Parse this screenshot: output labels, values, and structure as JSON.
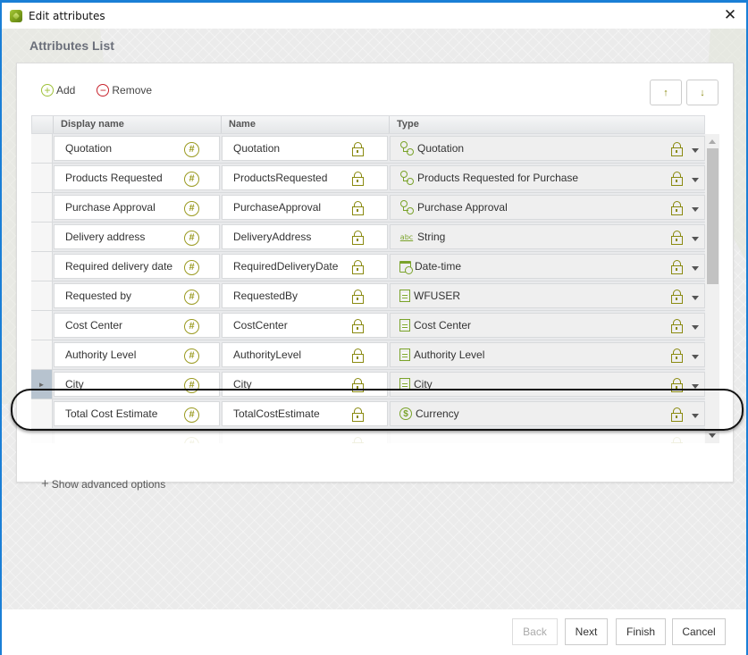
{
  "window": {
    "title": "Edit attributes",
    "close_icon": "close-icon"
  },
  "section_title": "Attributes List",
  "toolbar": {
    "add_label": "Add",
    "remove_label": "Remove",
    "move_up": "↑",
    "move_down": "↓"
  },
  "grid": {
    "columns": [
      "Display name",
      "Name",
      "Type"
    ],
    "rows": [
      {
        "display": "Quotation",
        "name": "Quotation",
        "type": "Quotation",
        "type_icon": "process",
        "selected": false
      },
      {
        "display": "Products Requested",
        "name": "ProductsRequested",
        "type": "Products Requested for Purchase",
        "type_icon": "process",
        "selected": false
      },
      {
        "display": "Purchase Approval",
        "name": "PurchaseApproval",
        "type": "Purchase Approval",
        "type_icon": "process",
        "selected": false
      },
      {
        "display": "Delivery address",
        "name": "DeliveryAddress",
        "type": "String",
        "type_icon": "string",
        "selected": false
      },
      {
        "display": "Required delivery date",
        "name": "RequiredDeliveryDate",
        "type": "Date-time",
        "type_icon": "date",
        "selected": false
      },
      {
        "display": "Requested by",
        "name": "RequestedBy",
        "type": "WFUSER",
        "type_icon": "entity",
        "selected": false
      },
      {
        "display": "Cost Center",
        "name": "CostCenter",
        "type": "Cost Center",
        "type_icon": "entity",
        "selected": false
      },
      {
        "display": "Authority Level",
        "name": "AuthorityLevel",
        "type": "Authority Level",
        "type_icon": "entity",
        "selected": false
      },
      {
        "display": "City",
        "name": "City",
        "type": "City",
        "type_icon": "entity",
        "selected": true
      },
      {
        "display": "Total Cost Estimate",
        "name": "TotalCostEstimate",
        "type": "Currency",
        "type_icon": "currency",
        "selected": false
      }
    ],
    "selected_row_indicator": "►"
  },
  "advanced_label": "Show advanced options",
  "footer": {
    "back": "Back",
    "next": "Next",
    "finish": "Finish",
    "cancel": "Cancel"
  },
  "colors": {
    "accent_green": "#7aa32a",
    "lock_olive": "#8a8a10",
    "remove_red": "#c8232c",
    "window_border": "#1a7fd6"
  }
}
